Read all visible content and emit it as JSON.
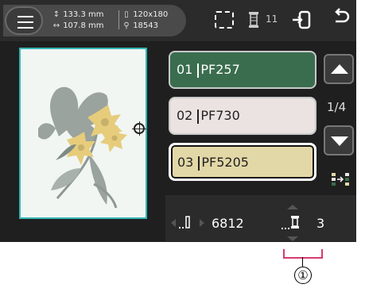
{
  "topbar": {
    "menu_icon": "menu-icon",
    "size_height": "133.3 mm",
    "size_width": "107.8 mm",
    "hoop_size": "120x180",
    "stitch_total": "18543",
    "thread_change_count": "11",
    "icons": [
      "frame-icon",
      "spool-icon",
      "import-icon",
      "back-icon"
    ]
  },
  "color_list": {
    "items": [
      {
        "index": "01",
        "code": "PF257",
        "color": "#3a6d4e"
      },
      {
        "index": "02",
        "code": "PF730",
        "color": "#ebe3e1"
      },
      {
        "index": "03",
        "code": "PF5205",
        "color": "#e2d7a6"
      }
    ],
    "selected": "03",
    "page": "1/4"
  },
  "status": {
    "stitch_count": "6812",
    "thread_position": "3"
  },
  "callout": {
    "label": "①"
  },
  "colors": {
    "background": "#262626",
    "canvas": "#f1f6f3",
    "canvas_border": "#35b6b6",
    "callout": "#d93a73"
  }
}
